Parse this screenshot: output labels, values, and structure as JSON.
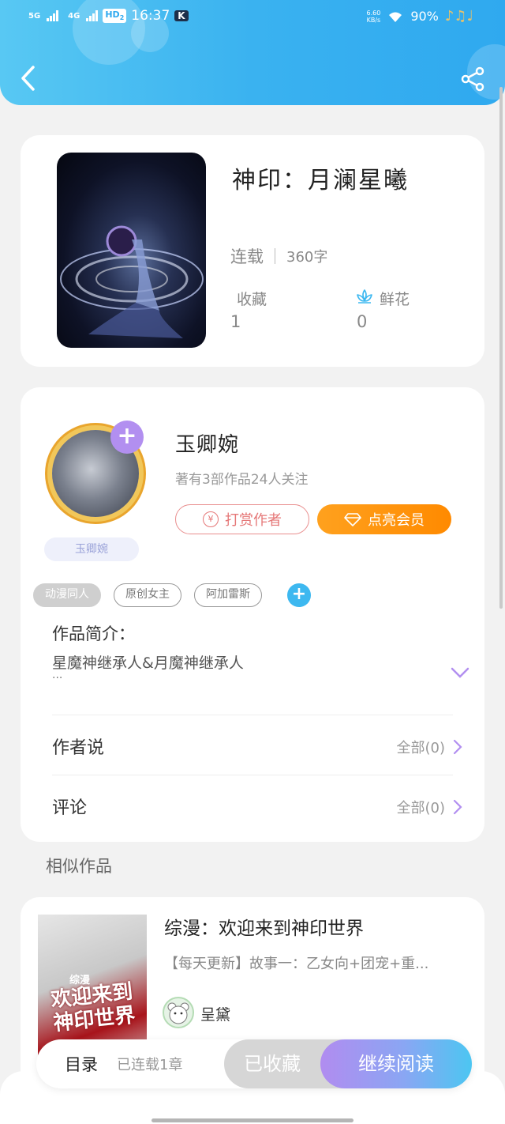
{
  "status_bar": {
    "signal_1": "5G",
    "signal_2": "4G",
    "hd": "HD",
    "hd_sub": "2",
    "time": "16:37",
    "app_badge": "K",
    "net_speed_value": "6.60",
    "net_speed_unit": "KB/s",
    "battery": "90%",
    "music_notes": "♪♫♩"
  },
  "header": {
    "back_icon": "chevron-left-icon",
    "share_icon": "share-icon",
    "gradient_colors": [
      "#58c8f3",
      "#2fa9ef"
    ]
  },
  "book": {
    "title": "神印：月澜星曦",
    "status": "连载",
    "word_count": "360字",
    "favorites_label": "收藏",
    "favorites_count": "1",
    "flowers_label": "鲜花",
    "flowers_count": "0"
  },
  "author": {
    "avatar_tag": "玉卿婉",
    "name": "玉卿婉",
    "description": "著有3部作品24人关注",
    "tip_icon": "¥",
    "tip_label": "打赏作者",
    "vip_label": "点亮会员"
  },
  "tags": [
    "动漫同人",
    "原创女主",
    "阿加雷斯"
  ],
  "intro": {
    "title": "作品简介：",
    "text": "星魔神继承人&月魔神继承人",
    "ellipsis": "..."
  },
  "rows": {
    "author_says_label": "作者说",
    "author_says_count": "全部(0)",
    "comments_label": "评论",
    "comments_count": "全部(0)"
  },
  "similar": {
    "section_label": "相似作品",
    "items": [
      {
        "cover_text": "欢迎来到神印世界",
        "cover_tag": "综漫",
        "title": "综漫：欢迎来到神印世界",
        "description": "【每天更新】故事一：乙女向+团宠+重...",
        "author": "呈黛"
      }
    ]
  },
  "bottom_bar": {
    "toc_label": "目录",
    "toc_count": "已连载1章",
    "collected_label": "已收藏",
    "read_label": "继续阅读"
  }
}
